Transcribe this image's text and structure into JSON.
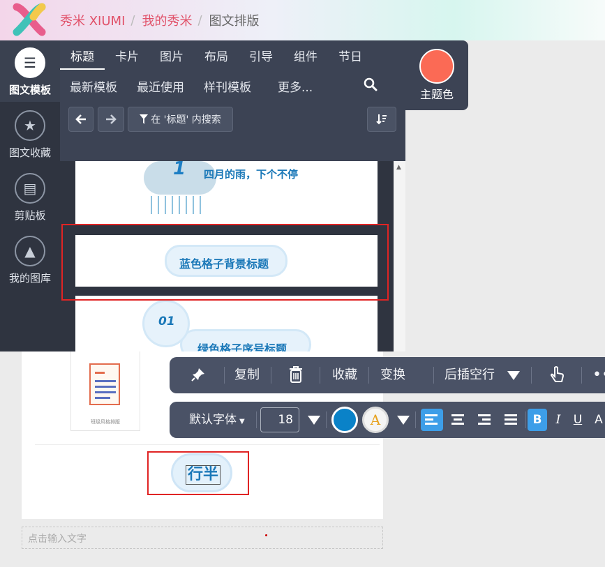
{
  "header": {
    "brand": "秀米 XIUMI",
    "crumb_2": "我的秀米",
    "crumb_3": "图文排版",
    "separator": "/"
  },
  "sidebar": {
    "items": [
      {
        "label": "图文模板",
        "icon": "list-icon",
        "active": true
      },
      {
        "label": "图文收藏",
        "icon": "starred-doc-icon"
      },
      {
        "label": "剪贴板",
        "icon": "clipboard-icon"
      },
      {
        "label": "我的图库",
        "icon": "image-gallery-icon"
      }
    ]
  },
  "panel": {
    "tabs": [
      "标题",
      "卡片",
      "图片",
      "布局",
      "引导",
      "组件",
      "节日"
    ],
    "subtabs": [
      "最新模板",
      "最近使用",
      "样刊模板",
      "更多..."
    ],
    "theme_label": "主题色",
    "theme_color": "#fb6a55",
    "filter_label": "在 '标题' 内搜索"
  },
  "templates": {
    "item1_number": "1",
    "item1_title": "四月的雨，下个不停",
    "item2_title": "蓝色格子背景标题",
    "item3_number": "01",
    "item3_title": "绿色格子序号标题"
  },
  "canvas": {
    "card_caption": "班级风格排版",
    "selected_text": "行半",
    "input_placeholder": "点击输入文字"
  },
  "toolbar1": {
    "copy": "复制",
    "favorite": "收藏",
    "transform": "变换",
    "insert_after": "后插空行"
  },
  "toolbar2": {
    "font_family": "默认字体",
    "font_size": "18",
    "text_color": "#0a82c8",
    "highlight_glyph": "A",
    "bold": "B",
    "italic": "I",
    "underline": "U",
    "more": "A"
  }
}
